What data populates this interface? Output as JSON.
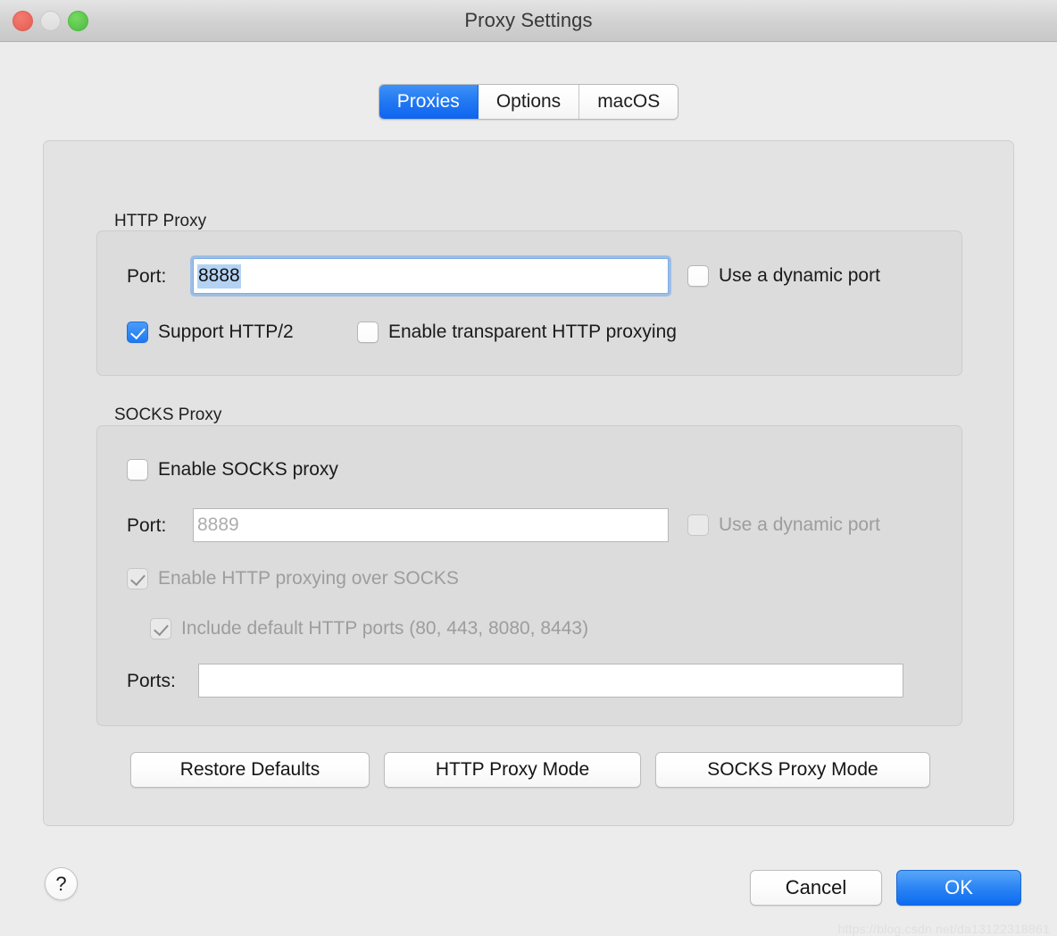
{
  "window": {
    "title": "Proxy Settings",
    "traffic_lights": [
      {
        "name": "close",
        "color": "#ec6a60"
      },
      {
        "name": "minimize",
        "color": "#e2e2e2"
      },
      {
        "name": "zoom",
        "color": "#5fc94f"
      }
    ]
  },
  "tabs": [
    {
      "label": "Proxies",
      "active": true
    },
    {
      "label": "Options",
      "active": false
    },
    {
      "label": "macOS",
      "active": false
    }
  ],
  "http_proxy": {
    "group_label": "HTTP Proxy",
    "port_label": "Port:",
    "port_value": "8888",
    "port_focused": true,
    "port_selected": true,
    "dynamic_port_label": "Use a dynamic port",
    "dynamic_port_checked": false,
    "support_http2_label": "Support HTTP/2",
    "support_http2_checked": true,
    "transparent_label": "Enable transparent HTTP proxying",
    "transparent_checked": false
  },
  "socks_proxy": {
    "group_label": "SOCKS Proxy",
    "enable_label": "Enable SOCKS proxy",
    "enable_checked": false,
    "port_label": "Port:",
    "port_placeholder": "8889",
    "port_value": "",
    "dynamic_port_label": "Use a dynamic port",
    "dynamic_port_checked": false,
    "dynamic_port_disabled": true,
    "http_over_socks_label": "Enable HTTP proxying over SOCKS",
    "http_over_socks_checked": true,
    "http_over_socks_disabled": true,
    "include_defaults_label": "Include default HTTP ports (80, 443, 8080, 8443)",
    "include_defaults_checked": true,
    "include_defaults_disabled": true,
    "ports_label": "Ports:",
    "ports_value": ""
  },
  "mode_buttons": {
    "restore_defaults": "Restore Defaults",
    "http_proxy_mode": "HTTP Proxy Mode",
    "socks_proxy_mode": "SOCKS Proxy Mode"
  },
  "footer": {
    "help": "?",
    "cancel": "Cancel",
    "ok": "OK"
  },
  "watermark": "https://blog.csdn.net/da13122318861",
  "colors": {
    "accent": "#1d7af2",
    "window_bg": "#ececec",
    "panel_bg": "#e3e3e3",
    "group_bg": "#dcdcdc",
    "selection": "#b4d3f4",
    "disabled_text": "#9d9d9d"
  }
}
